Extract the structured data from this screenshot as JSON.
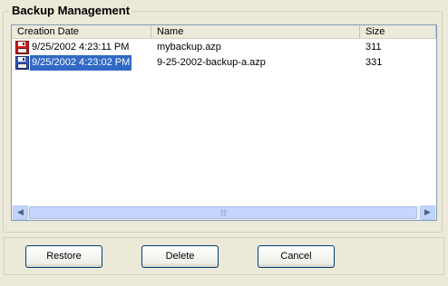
{
  "group": {
    "title": "Backup Management"
  },
  "listview": {
    "columns": [
      "Creation Date",
      "Name",
      "Size"
    ],
    "rows": [
      {
        "date": "9/25/2002 4:23:11 PM",
        "name": "mybackup.azp",
        "size": "311",
        "icon": "floppy-disk-icon",
        "selected": false
      },
      {
        "date": "9/25/2002 4:23:02 PM",
        "name": "9-25-2002-backup-a.azp",
        "size": "331",
        "icon": "floppy-disk-icon",
        "selected": true
      }
    ],
    "scrollbar": {
      "grip": "||||"
    }
  },
  "buttons": {
    "restore": "Restore",
    "delete": "Delete",
    "cancel": "Cancel"
  },
  "colors": {
    "window_bg": "#ECE9D8",
    "selection": "#316AC5",
    "icon_red": "#D11F1F",
    "icon_blue": "#3D5FBE",
    "button_border": "#003C74"
  }
}
